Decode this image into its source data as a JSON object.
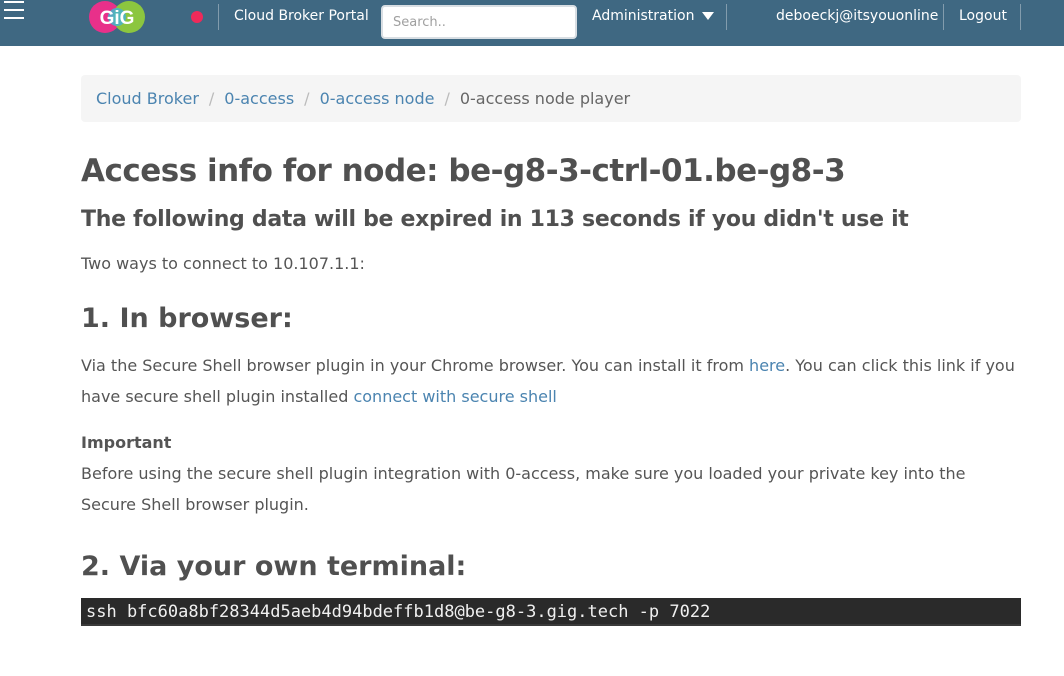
{
  "header": {
    "logo_text": "GiG",
    "portal_label": "Cloud Broker Portal",
    "search_placeholder": "Search..",
    "admin_label": "Administration",
    "user_email": "deboeckj@itsyouonline",
    "logout_label": "Logout",
    "status_color": "#ee2a5a",
    "bar_color": "#3f6882"
  },
  "breadcrumb": {
    "items": [
      "Cloud Broker",
      "0-access",
      "0-access node"
    ],
    "active": "0-access node player",
    "separator": "/"
  },
  "main": {
    "title": "Access info for node: be-g8-3-ctrl-01.be-g8-3",
    "expiry_text": "The following data will be expired in 113 seconds if you didn't use it",
    "connect_intro": "Two ways to connect to 10.107.1.1:",
    "browser_heading": "1. In browser:",
    "browser_text_1": "Via the Secure Shell browser plugin in your Chrome browser. You can install it from ",
    "here_link": "here",
    "browser_text_2": ". You can click this link if you have secure shell plugin installed ",
    "secure_shell_link": "connect with secure shell",
    "important_label": "Important",
    "important_text": "Before using the secure shell plugin integration with 0-access, make sure you loaded your private key into the Secure Shell browser plugin.",
    "terminal_heading": "2. Via your own terminal:",
    "ssh_command": "ssh bfc60a8bf28344d5aeb4d94bdeffb1d8@be-g8-3.gig.tech -p 7022"
  }
}
